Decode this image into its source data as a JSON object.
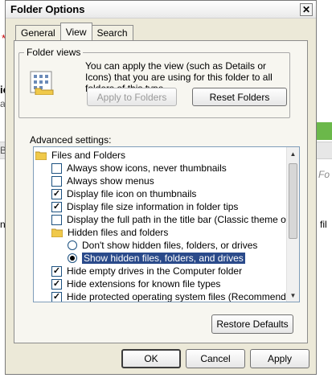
{
  "window": {
    "title": "Folder Options"
  },
  "tabs": [
    {
      "label": "General",
      "active": false
    },
    {
      "label": "View",
      "active": true
    },
    {
      "label": "Search",
      "active": false
    }
  ],
  "folder_views": {
    "label": "Folder views",
    "description": "You can apply the view (such as Details or Icons) that you are using for this folder to all folders of this type.",
    "apply_button": "Apply to Folders",
    "reset_button": "Reset Folders"
  },
  "advanced": {
    "label": "Advanced settings:",
    "items": [
      {
        "type": "folder",
        "label": "Files and Folders"
      },
      {
        "type": "checkbox",
        "checked": false,
        "label": "Always show icons, never thumbnails"
      },
      {
        "type": "checkbox",
        "checked": false,
        "label": "Always show menus"
      },
      {
        "type": "checkbox",
        "checked": true,
        "label": "Display file icon on thumbnails"
      },
      {
        "type": "checkbox",
        "checked": true,
        "label": "Display file size information in folder tips"
      },
      {
        "type": "checkbox",
        "checked": false,
        "label": "Display the full path in the title bar (Classic theme only)"
      },
      {
        "type": "folder",
        "label": "Hidden files and folders"
      },
      {
        "type": "radio",
        "checked": false,
        "label": "Don't show hidden files, folders, or drives"
      },
      {
        "type": "radio",
        "checked": true,
        "label": "Show hidden files, folders, and drives"
      },
      {
        "type": "checkbox",
        "checked": true,
        "label": "Hide empty drives in the Computer folder"
      },
      {
        "type": "checkbox",
        "checked": true,
        "label": "Hide extensions for known file types"
      },
      {
        "type": "checkbox",
        "checked": true,
        "label": "Hide protected operating system files (Recommended)"
      }
    ],
    "restore_button": "Restore Defaults"
  },
  "footer": {
    "ok": "OK",
    "cancel": "Cancel",
    "apply": "Apply"
  },
  "background": {
    "left_fragments": [
      "*",
      "ic",
      "as",
      "Bo",
      "n"
    ],
    "right_fragments": [
      "Fo",
      "fil"
    ]
  },
  "colors": {
    "selection": "#2a4a8a",
    "dialog_bg": "#ece9d8"
  }
}
